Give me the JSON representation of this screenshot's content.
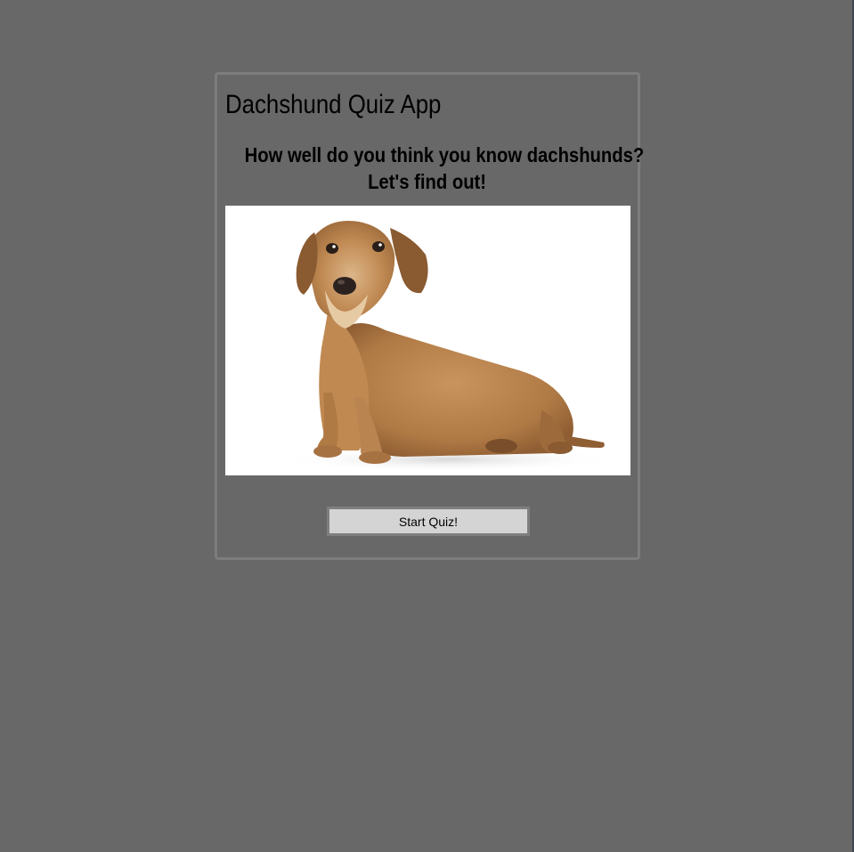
{
  "app": {
    "title": "Dachshund Quiz App",
    "tagline_line1": "How well do you think you know dachshunds?",
    "tagline_line2": "Let's find out!"
  },
  "hero_image": {
    "subject": "wire-haired dachshund sitting"
  },
  "actions": {
    "start_label": "Start Quiz!"
  },
  "colors": {
    "page_background": "#686868",
    "card_border": "#7d7d7d",
    "button_background": "#d4d4d4",
    "button_border": "#7f7f7f"
  }
}
